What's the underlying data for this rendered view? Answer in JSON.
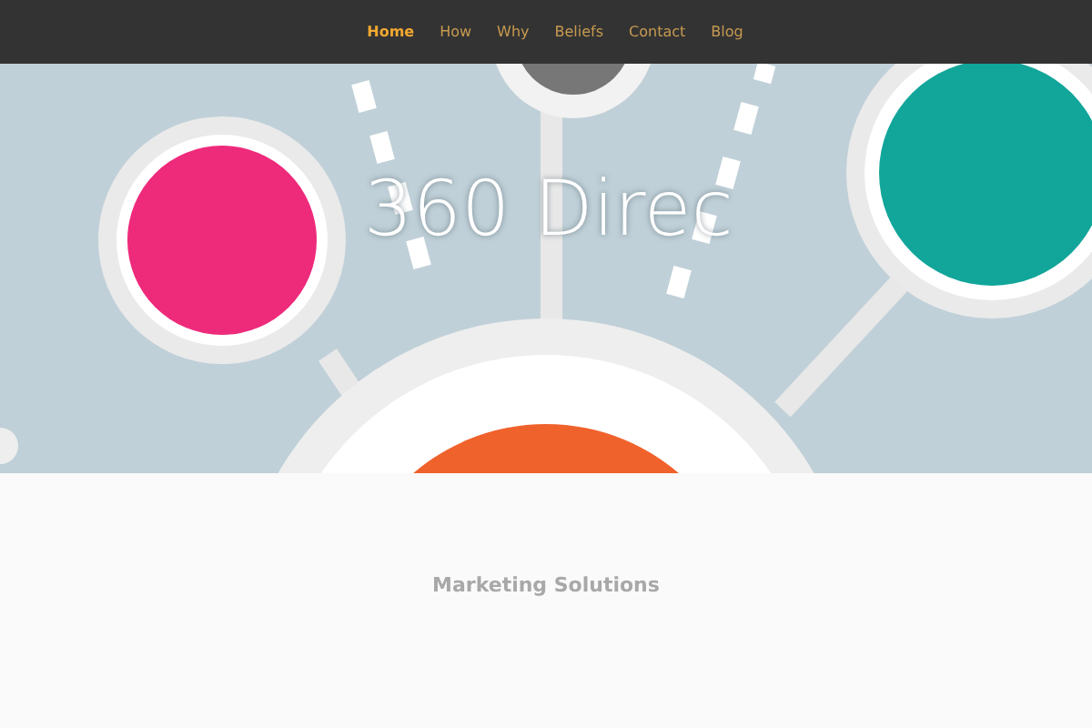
{
  "nav": {
    "items": [
      {
        "label": "Home",
        "selected": true
      },
      {
        "label": "How",
        "selected": false
      },
      {
        "label": "Why",
        "selected": false
      },
      {
        "label": "Beliefs",
        "selected": false
      },
      {
        "label": "Contact",
        "selected": false
      },
      {
        "label": "Blog",
        "selected": false
      }
    ]
  },
  "hero": {
    "title": "360 Direc"
  },
  "section": {
    "heading": "Marketing Solutions"
  }
}
